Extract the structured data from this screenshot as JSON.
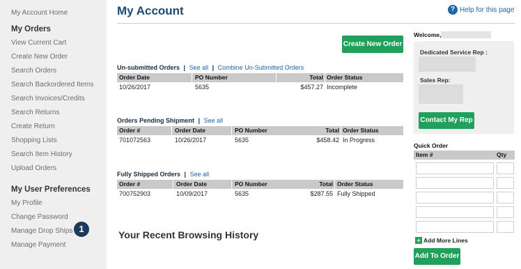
{
  "sidebar": {
    "home": "My Account Home",
    "orders_heading": "My Orders",
    "orders_items": [
      "View Current Cart",
      "Create New Order",
      "Search Orders",
      "Search Backordered Items",
      "Search Invoices/Credits",
      "Search Returns",
      "Create Return",
      "Shopping Lists",
      "Search Item History",
      "Upload Orders"
    ],
    "prefs_heading": "My User Preferences",
    "prefs_items": [
      "My Profile",
      "Change Password",
      "Manage Drop Ships",
      "Manage Payment"
    ],
    "step_badge": "1"
  },
  "main": {
    "title": "My Account",
    "help_label": "Help for this page",
    "create_order_label": "Create New Order",
    "unsubmitted": {
      "title": "Un-submitted Orders",
      "see_all": "See all",
      "combine": "Combine Un-Submitted Orders",
      "columns": [
        "Order Date",
        "PO Number",
        "Total",
        "Order Status"
      ],
      "rows": [
        [
          "10/26/2017",
          "5635",
          "$457.27",
          "Incomplete"
        ]
      ]
    },
    "pending": {
      "title": "Orders Pending Shipment",
      "see_all": "See all",
      "columns": [
        "Order #",
        "Order Date",
        "PO Number",
        "Total",
        "Order Status"
      ],
      "rows": [
        [
          "701072563",
          "10/26/2017",
          "5635",
          "$458.42",
          "In Progress"
        ]
      ]
    },
    "shipped": {
      "title": "Fully Shipped Orders",
      "see_all": "See all",
      "columns": [
        "Order #",
        "Order Date",
        "PO Number",
        "Total",
        "Order Status"
      ],
      "rows": [
        [
          "700752903",
          "10/09/2017",
          "5635",
          "$287.55",
          "Fully Shipped"
        ]
      ]
    },
    "recent_title": "Your Recent Browsing History"
  },
  "right": {
    "welcome": "Welcome,",
    "service_rep_label": "Dedicated Service Rep :",
    "sales_rep_label": "Sales Rep:",
    "contact_label": "Contact My Rep",
    "quick_order_title": "Quick Order",
    "item_col": "Item #",
    "qty_col": "Qty",
    "add_lines_label": "Add More Lines",
    "add_to_order_label": "Add To Order"
  },
  "colors": {
    "accent_green": "#20a05a",
    "title_blue": "#1d4a73",
    "link_blue": "#1f63a8",
    "badge_navy": "#1b3a5c"
  }
}
